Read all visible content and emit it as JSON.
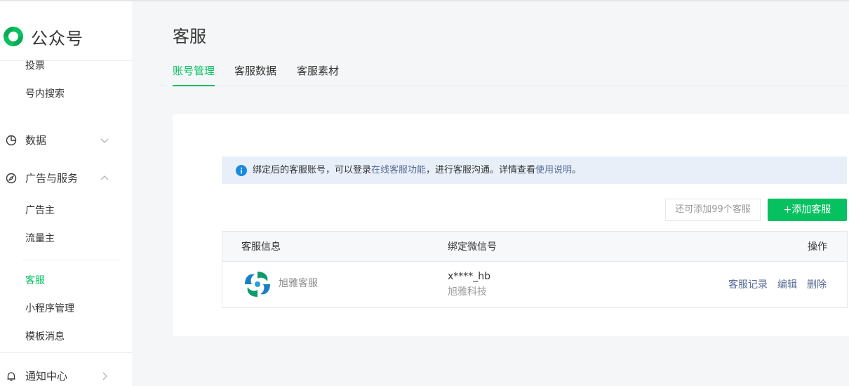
{
  "app": {
    "name": "公众号"
  },
  "sidebar": {
    "items_top": [
      {
        "label": "投票"
      },
      {
        "label": "号内搜索"
      }
    ],
    "groups": [
      {
        "label": "数据",
        "icon": "pie-chart-icon",
        "expanded": false
      },
      {
        "label": "广告与服务",
        "icon": "compass-icon",
        "expanded": true
      },
      {
        "label": "通知中心",
        "icon": "bell-icon",
        "expanded": false
      }
    ],
    "ads_items": [
      {
        "label": "广告主"
      },
      {
        "label": "流量主"
      }
    ],
    "service_items": [
      {
        "label": "客服",
        "active": true
      },
      {
        "label": "小程序管理"
      },
      {
        "label": "模板消息"
      }
    ]
  },
  "main": {
    "title": "客服",
    "tabs": [
      {
        "label": "账号管理",
        "active": true
      },
      {
        "label": "客服数据"
      },
      {
        "label": "客服素材"
      }
    ],
    "notice": {
      "prefix": "绑定后的客服账号，可以登录",
      "link1": "在线客服功能",
      "middle": "，进行客服沟通。详情查看",
      "link2": "使用说明",
      "suffix": "。"
    },
    "quota_text": "还可添加99个客服",
    "add_button": "+添加客服",
    "table": {
      "headers": [
        "客服信息",
        "绑定微信号",
        "操作"
      ],
      "rows": [
        {
          "name": "旭雅客服",
          "wechat_id": "x****_hb",
          "wechat_org": "旭雅科技",
          "actions": [
            "客服记录",
            "编辑",
            "删除"
          ]
        }
      ]
    }
  },
  "colors": {
    "accent": "#07c160",
    "link": "#576b95",
    "notice_bg": "#e8eff9",
    "info_icon": "#1a8ae0"
  }
}
